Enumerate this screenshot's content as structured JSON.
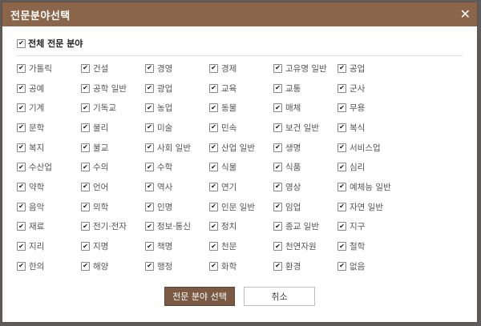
{
  "dialog": {
    "title": "전문분야선택",
    "close_symbol": "✕"
  },
  "select_all": {
    "label": "전체 전문 분야",
    "checked": true
  },
  "fields": [
    "가톨릭",
    "건설",
    "경영",
    "경제",
    "고유명 일반",
    "공업",
    "공예",
    "공학 일반",
    "광업",
    "교육",
    "교통",
    "군사",
    "기계",
    "기독교",
    "농업",
    "동물",
    "매체",
    "무용",
    "문학",
    "물리",
    "미술",
    "민속",
    "보건 일반",
    "복식",
    "복지",
    "불교",
    "사회 일반",
    "산업 일반",
    "생명",
    "서비스업",
    "수산업",
    "수의",
    "수학",
    "식물",
    "식품",
    "심리",
    "약학",
    "언어",
    "역사",
    "연기",
    "영상",
    "예체능 일반",
    "음악",
    "의학",
    "인명",
    "인문 일반",
    "임업",
    "자연 일반",
    "재료",
    "전기·전자",
    "정보·통신",
    "정치",
    "종교 일반",
    "지구",
    "지리",
    "지명",
    "책명",
    "천문",
    "천연자원",
    "철학",
    "한의",
    "해양",
    "행정",
    "화학",
    "환경",
    "없음"
  ],
  "check_symbol": "✔",
  "buttons": {
    "confirm": "전문 분야 선택",
    "cancel": "취소"
  }
}
